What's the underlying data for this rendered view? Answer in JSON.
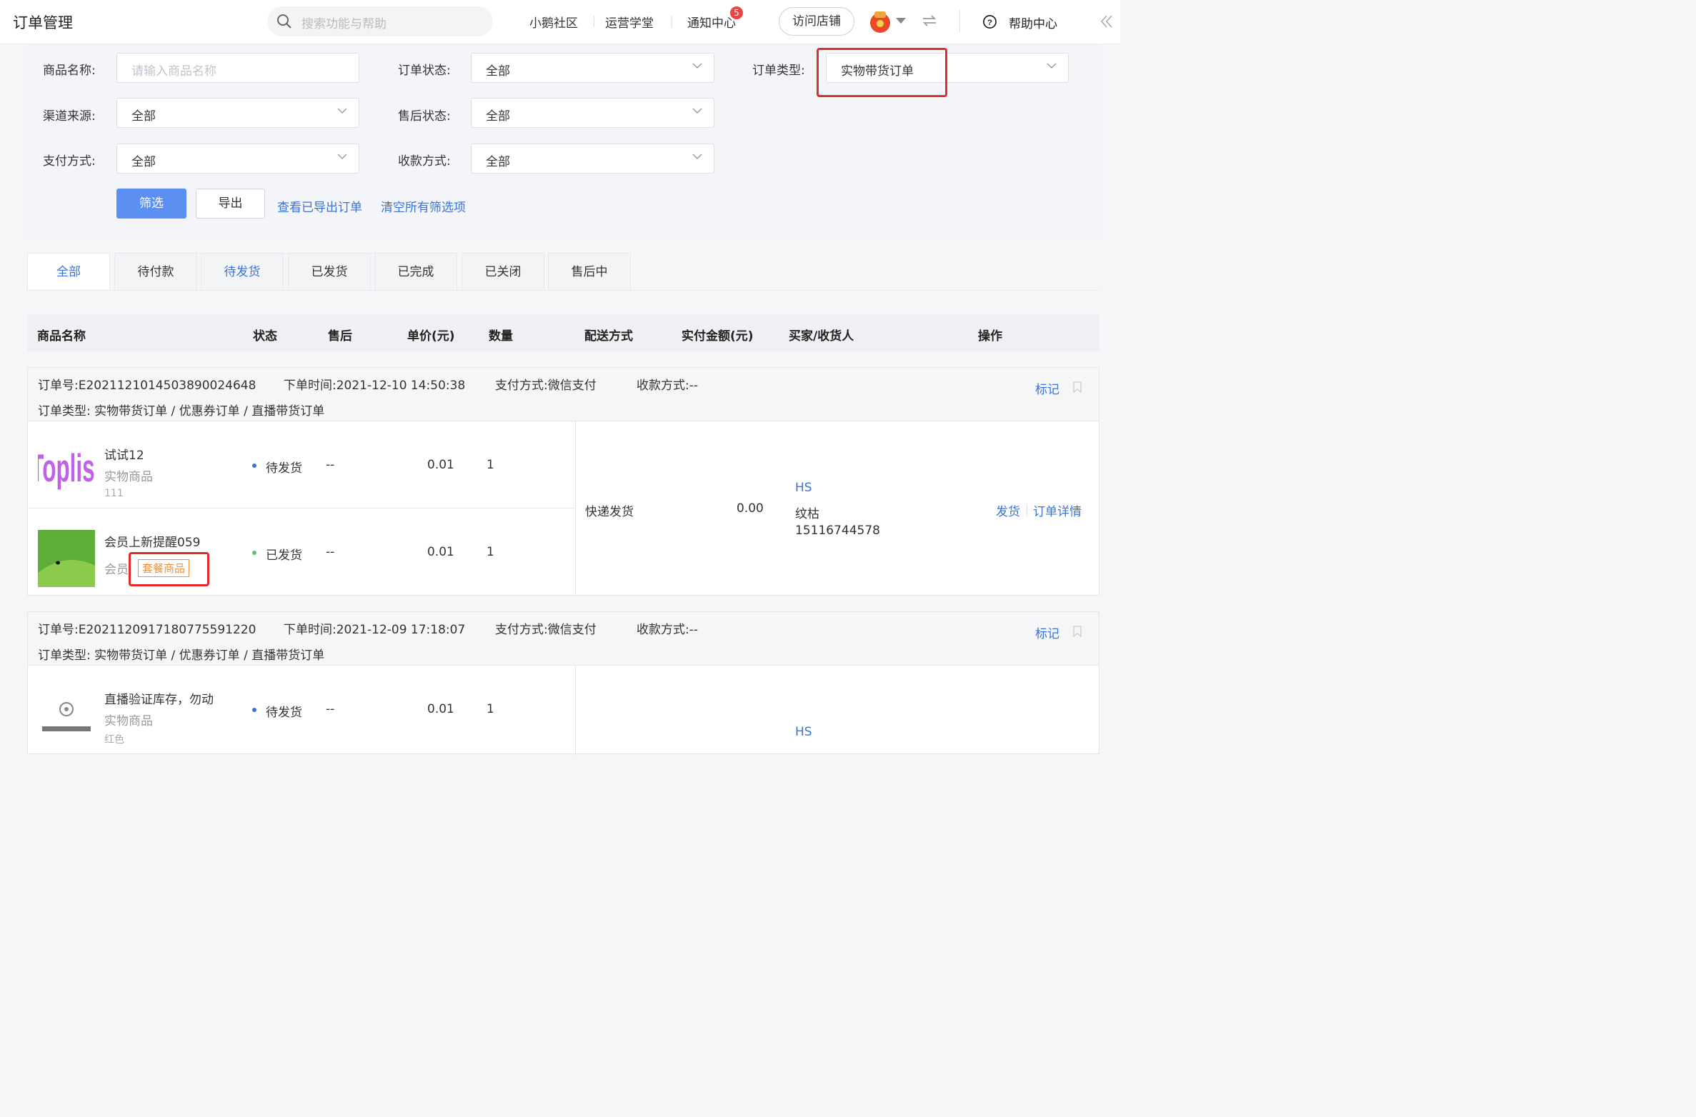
{
  "header": {
    "title": "订单管理",
    "search_placeholder": "搜索功能与帮助",
    "nav": [
      "小鹅社区",
      "运营学堂",
      "通知中心"
    ],
    "notice_count": "5",
    "visit_store": "访问店铺",
    "help": "帮助中心"
  },
  "filters": {
    "product_name_label": "商品名称:",
    "product_name_placeholder": "请输入商品名称",
    "order_status_label": "订单状态:",
    "order_status_value": "全部",
    "order_type_label": "订单类型:",
    "order_type_value": "实物带货订单",
    "channel_label": "渠道来源:",
    "channel_value": "全部",
    "aftersale_label": "售后状态:",
    "aftersale_value": "全部",
    "pay_method_label": "支付方式:",
    "pay_method_value": "全部",
    "collect_label": "收款方式:",
    "collect_value": "全部",
    "filter_btn": "筛选",
    "export_btn": "导出",
    "view_exported": "查看已导出订单",
    "clear_all": "清空所有筛选项"
  },
  "tabs": [
    "全部",
    "待付款",
    "待发货",
    "已发货",
    "已完成",
    "已关闭",
    "售后中"
  ],
  "table_headers": [
    "商品名称",
    "状态",
    "售后",
    "单价(元)",
    "数量",
    "配送方式",
    "实付金额(元)",
    "买家/收货人",
    "操作"
  ],
  "orders": [
    {
      "order_no": "订单号:E20211210145038900246​48",
      "order_time": "下单时间:2021-12-10 14:50:38",
      "pay_method": "支付方式:微信支付",
      "collect": "收款方式:--",
      "order_type": "订单类型: 实物带货订单 / 优惠券订单 / 直播带货订单",
      "mark": "标记",
      "delivery": "快递发货",
      "paid": "0.00",
      "buyer_name": "HS",
      "receiver": "纹枯",
      "phone": "15116744578",
      "actions": [
        "发货",
        "订单详情"
      ],
      "items": [
        {
          "name": "试试12",
          "type": "实物商品",
          "sku": "111",
          "status": "待发货",
          "status_color": "#3a73d8",
          "aftersale": "--",
          "price": "0.01",
          "qty": "1"
        },
        {
          "name": "会员上新提醒059",
          "type": "会员",
          "tag": "套餐商品",
          "status": "已发货",
          "status_color": "#5cc36b",
          "aftersale": "--",
          "price": "0.01",
          "qty": "1"
        }
      ]
    },
    {
      "order_no": "订单号:E20211209171807755912​20",
      "order_time": "下单时间:2021-12-09 17:18:07",
      "pay_method": "支付方式:微信支付",
      "collect": "收款方式:--",
      "order_type": "订单类型: 实物带货订单 / 优惠券订单 / 直播带货订单",
      "mark": "标记",
      "buyer_name": "HS",
      "items": [
        {
          "name": "直播验证库存，勿动",
          "type": "实物商品",
          "sku": "红色",
          "status": "待发货",
          "status_color": "#3a73d8",
          "aftersale": "--",
          "price": "0.01",
          "qty": "1"
        }
      ]
    }
  ]
}
